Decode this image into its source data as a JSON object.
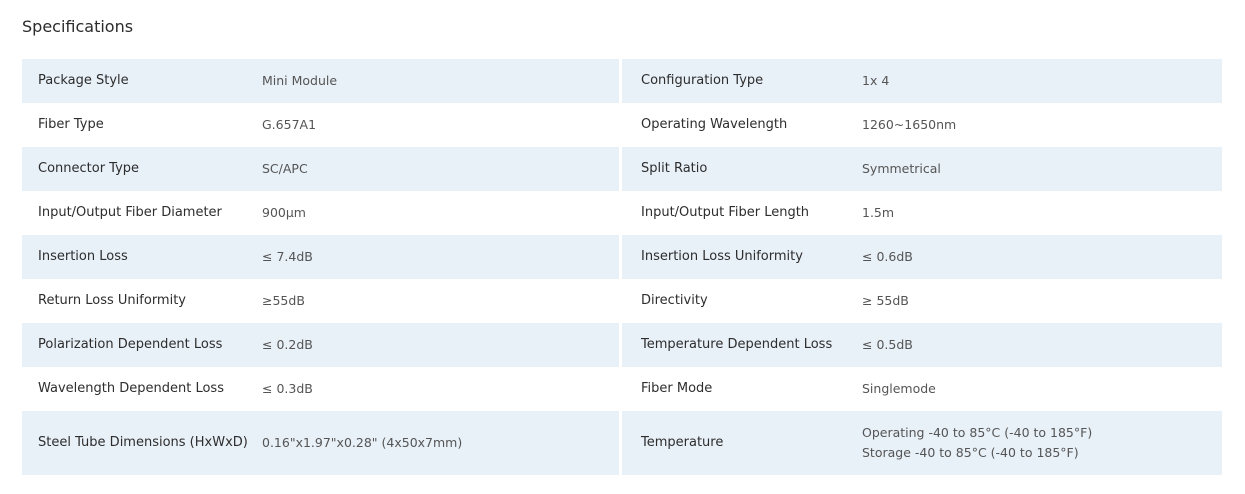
{
  "heading": "Specifications",
  "rows": [
    {
      "left_label": "Package Style",
      "left_value": "Mini Module",
      "right_label": "Configuration Type",
      "right_value": "1x 4"
    },
    {
      "left_label": "Fiber Type",
      "left_value": "G.657A1",
      "right_label": "Operating Wavelength",
      "right_value": "1260~1650nm"
    },
    {
      "left_label": "Connector Type",
      "left_value": "SC/APC",
      "right_label": "Split Ratio",
      "right_value": "Symmetrical"
    },
    {
      "left_label": "Input/Output Fiber Diameter",
      "left_value": "900μm",
      "right_label": "Input/Output Fiber Length",
      "right_value": "1.5m"
    },
    {
      "left_label": "Insertion Loss",
      "left_value": "≤ 7.4dB",
      "right_label": "Insertion Loss Uniformity",
      "right_value": "≤ 0.6dB"
    },
    {
      "left_label": "Return Loss Uniformity",
      "left_value": "≥55dB",
      "right_label": "Directivity",
      "right_value": "≥ 55dB"
    },
    {
      "left_label": "Polarization Dependent Loss",
      "left_value": "≤ 0.2dB",
      "right_label": "Temperature Dependent Loss",
      "right_value": "≤ 0.5dB"
    },
    {
      "left_label": "Wavelength Dependent Loss",
      "left_value": "≤ 0.3dB",
      "right_label": "Fiber Mode",
      "right_value": "Singlemode"
    },
    {
      "left_label": "Steel Tube Dimensions (HxWxD)",
      "left_value": "0.16\"x1.97\"x0.28\" (4x50x7mm)",
      "right_label": "Temperature",
      "right_value_line1": "Operating -40 to 85°C (-40 to 185°F)",
      "right_value_line2": "Storage -40 to 85°C (-40 to 185°F)"
    }
  ],
  "colors": {
    "row_shade": "#e8f0f8",
    "label_text": "#2d2d2d",
    "value_text": "#555555"
  }
}
